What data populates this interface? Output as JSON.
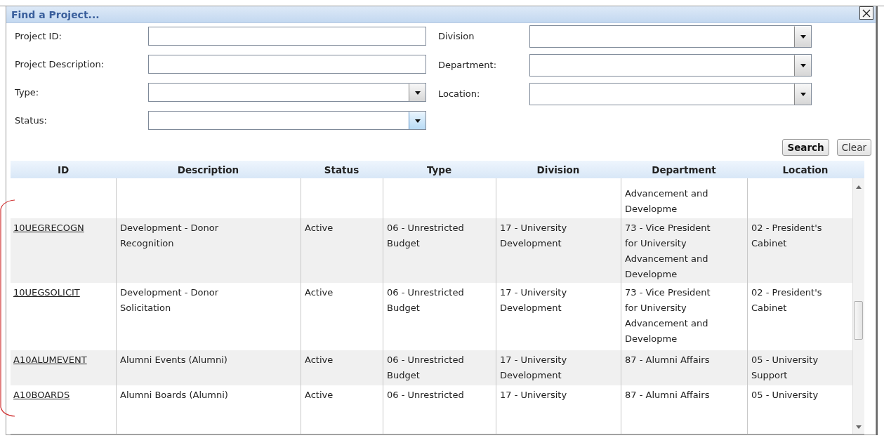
{
  "dialog": {
    "title": "Find a Project..."
  },
  "left_fields": [
    {
      "label": "Project ID:",
      "kind": "text"
    },
    {
      "label": "Project Description:",
      "kind": "text"
    },
    {
      "label": "Type:",
      "kind": "select",
      "focused": false
    },
    {
      "label": "Status:",
      "kind": "select",
      "focused": true
    }
  ],
  "right_fields": [
    {
      "label": "Division",
      "kind": "select",
      "focused": false
    },
    {
      "label": "Department:",
      "kind": "select",
      "focused": false
    },
    {
      "label": "Location:",
      "kind": "select",
      "focused": false
    }
  ],
  "buttons": [
    {
      "label": "Search",
      "kind": "primary"
    },
    {
      "label": "Clear",
      "kind": "secondary"
    }
  ],
  "table": {
    "columns": [
      "ID",
      "Description",
      "Status",
      "Type",
      "Division",
      "Department",
      "Location"
    ],
    "rows": [
      {
        "id": "",
        "description": "",
        "status": "",
        "type": "",
        "division": "",
        "department": "Advancement and Developme",
        "location": ""
      },
      {
        "id": "10UEGRECOGN",
        "description": "Development - Donor Recognition",
        "status": "Active",
        "type": "06 - Unrestricted Budget",
        "division": "17 - University Development",
        "department": "73 - Vice President for University Advancement and Developme",
        "location": "02 - President's Cabinet"
      },
      {
        "id": "10UEGSOLICIT",
        "description": "Development - Donor Solicitation",
        "status": "Active",
        "type": "06 - Unrestricted Budget",
        "division": "17 - University Development",
        "department": "73 - Vice President for University Advancement and Developme",
        "location": "02 - President's Cabinet"
      },
      {
        "id": "A10ALUMEVENT",
        "description": "Alumni Events (Alumni)",
        "status": "Active",
        "type": "06 - Unrestricted Budget",
        "division": "17 - University Development",
        "department": "87 - Alumni Affairs",
        "location": "05 - University Support"
      },
      {
        "id": "A10BOARDS",
        "description": "Alumni Boards (Alumni)",
        "status": "Active",
        "type": "06 - Unrestricted",
        "division": "17 - University",
        "department": "87 - Alumni Affairs",
        "location": "05 - University"
      }
    ]
  }
}
